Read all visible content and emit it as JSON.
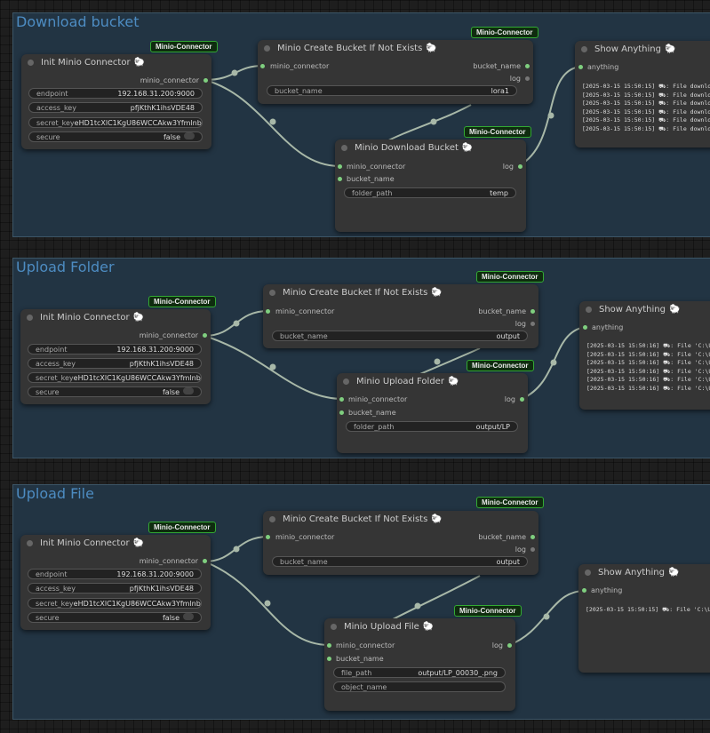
{
  "groups": [
    {
      "title": "Download bucket"
    },
    {
      "title": "Upload Folder"
    },
    {
      "title": "Upload File"
    }
  ],
  "tag_label": "Minio-Connector",
  "init": {
    "title": "Init Minio Connector",
    "output": "minio_connector",
    "fields": [
      {
        "k": "endpoint",
        "v": "192.168.31.200:9000"
      },
      {
        "k": "access_key",
        "v": "pfjKthK1ihsVDE48"
      },
      {
        "k": "secret_key",
        "v": "eHD1tcXlC1KgU86WCCAkw3Yfmlnbhf"
      },
      {
        "k": "secure",
        "v": "false"
      }
    ]
  },
  "create": {
    "title": "Minio Create Bucket If Not Exists",
    "input": "minio_connector",
    "out1": "bucket_name",
    "out2": "log",
    "field_k": "bucket_name"
  },
  "show": {
    "title": "Show Anything",
    "input": "anything"
  },
  "nodes": {
    "download": {
      "title": "Minio Download Bucket",
      "in1": "minio_connector",
      "in2": "bucket_name",
      "out": "log",
      "field_k": "folder_path",
      "field_v": "temp"
    },
    "upload_folder": {
      "title": "Minio Upload Folder",
      "in1": "minio_connector",
      "in2": "bucket_name",
      "out": "log",
      "field_k": "folder_path",
      "field_v": "output/LP"
    },
    "upload_file": {
      "title": "Minio Upload File",
      "in1": "minio_connector",
      "in2": "bucket_name",
      "out": "log",
      "field_k": "file_path",
      "field_v": "output/LP_00030_.png",
      "field2_k": "object_name"
    }
  },
  "bucket_values": [
    "lora1",
    "output",
    "output"
  ],
  "logs": {
    "g1": "[2025-03-15 15:50:15] ⛟: File downloa\n[2025-03-15 15:50:15] ⛟: File downloa\n[2025-03-15 15:50:15] ⛟: File downloa\n[2025-03-15 15:50:15] ⛟: File downloa\n[2025-03-15 15:50:15] ⛟: File downloa\n[2025-03-15 15:50:15] ⛟: File downloa",
    "g2": "[2025-03-15 15:50:16] ⛟: File 'C:\\U\n[2025-03-15 15:50:16] ⛟: File 'C:\\U\n[2025-03-15 15:50:16] ⛟: File 'C:\\U\n[2025-03-15 15:50:16] ⛟: File 'C:\\U\n[2025-03-15 15:50:16] ⛟: File 'C:\\U\n[2025-03-15 15:50:16] ⛟: File 'C:\\U",
    "g3": "[2025-03-15 15:50:15] ⛟: File 'C:\\U"
  },
  "icons": {
    "node_icon": "sheep-icon",
    "status_dot": "status-dot"
  },
  "colors": {
    "group_bg": "#223443",
    "group_title": "#4d8cc2",
    "node_bg": "#353535",
    "pin": "#7fcf7f",
    "wire": "#a8b8a8",
    "tag_bg": "#0f2c0f"
  }
}
